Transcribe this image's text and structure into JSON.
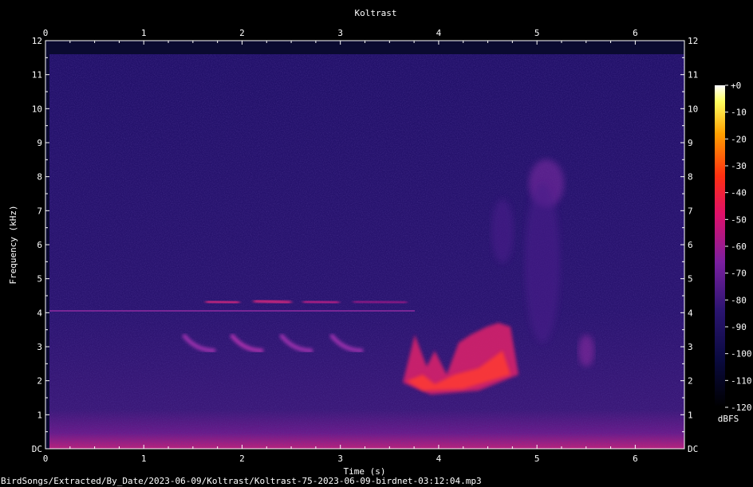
{
  "chart_data": {
    "type": "heatmap",
    "title": "Koltrast",
    "xlabel": "Time (s)",
    "ylabel": "Frequency (kHz)",
    "xlim": [
      0,
      6.5
    ],
    "ylim": [
      0,
      12
    ],
    "x_ticks": [
      "0",
      "1",
      "2",
      "3",
      "4",
      "5",
      "6"
    ],
    "y_ticks": [
      "DC",
      "1",
      "2",
      "3",
      "4",
      "5",
      "6",
      "7",
      "8",
      "9",
      "10",
      "11",
      "12"
    ],
    "colorbar": {
      "label": "dBFS",
      "range": [
        -120,
        0
      ],
      "ticks": [
        "+0",
        "-10",
        "-20",
        "-30",
        "-40",
        "-50",
        "-60",
        "-70",
        "-80",
        "-90",
        "-100",
        "-110",
        "-120"
      ]
    },
    "colors": {
      "background": "#000000",
      "noise_floor": "#2a1470",
      "mid": "#7a1fa0",
      "hot": "#ff1a40",
      "peak": "#ffffe0"
    },
    "footer": "BirdSongs/Extracted/By_Date/2023-06-09/Koltrast/Koltrast-75-2023-06-09-birdnet-03:12:04.mp3"
  }
}
